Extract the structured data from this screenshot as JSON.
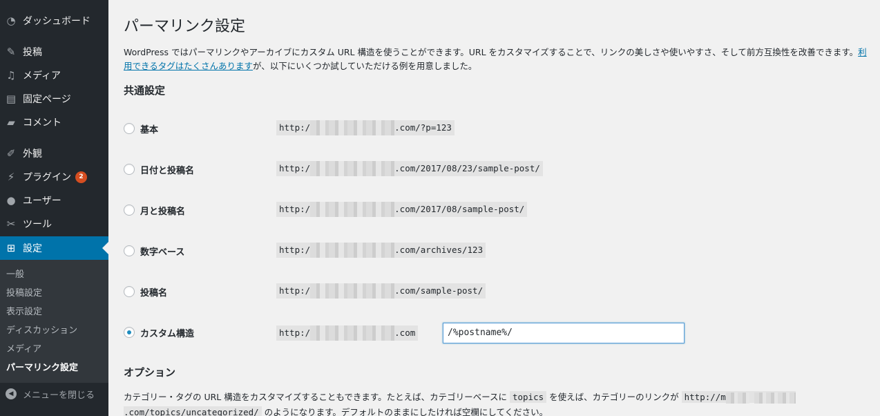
{
  "sidebar": {
    "items": [
      {
        "name": "dashboard",
        "label": "ダッシュボード",
        "icon": "dashboard-icon"
      },
      {
        "name": "posts",
        "label": "投稿",
        "icon": "pin-icon"
      },
      {
        "name": "media",
        "label": "メディア",
        "icon": "media-icon"
      },
      {
        "name": "pages",
        "label": "固定ページ",
        "icon": "page-icon"
      },
      {
        "name": "comments",
        "label": "コメント",
        "icon": "comment-icon"
      },
      {
        "name": "appearance",
        "label": "外観",
        "icon": "brush-icon"
      },
      {
        "name": "plugins",
        "label": "プラグイン",
        "icon": "plugin-icon",
        "badge": "2"
      },
      {
        "name": "users",
        "label": "ユーザー",
        "icon": "user-icon"
      },
      {
        "name": "tools",
        "label": "ツール",
        "icon": "wrench-icon"
      },
      {
        "name": "settings",
        "label": "設定",
        "icon": "settings-icon",
        "current": true
      }
    ],
    "submenu": [
      "一般",
      "投稿設定",
      "表示設定",
      "ディスカッション",
      "メディア",
      "パーマリンク設定"
    ],
    "collapse_label": "メニューを閉じる"
  },
  "main": {
    "title": "パーマリンク設定",
    "intro_before": "WordPress ではパーマリンクやアーカイブにカスタム URL 構造を使うことができます。URL をカスタマイズすることで、リンクの美しさや使いやすさ、そして前方互換性を改善できます。",
    "intro_link": "利用できるタグはたくさんあります",
    "intro_after": "が、以下にいくつか試していただける例を用意しました。",
    "common_heading": "共通設定",
    "options": [
      {
        "label": "基本",
        "prefix": "http:/",
        "suffix": ".com/?p=123",
        "checked": false
      },
      {
        "label": "日付と投稿名",
        "prefix": "http:/",
        "suffix": ".com/2017/08/23/sample-post/",
        "checked": false
      },
      {
        "label": "月と投稿名",
        "prefix": "http:/",
        "suffix": ".com/2017/08/sample-post/",
        "checked": false
      },
      {
        "label": "数字ベース",
        "prefix": "http:/",
        "suffix": ".com/archives/123",
        "checked": false
      },
      {
        "label": "投稿名",
        "prefix": "http:/",
        "suffix": ".com/sample-post/",
        "checked": false
      },
      {
        "label": "カスタム構造",
        "prefix": "http:/",
        "suffix": ".com",
        "checked": true,
        "input_value": "/%postname%/"
      }
    ],
    "options_heading": "オプション",
    "options_text_1": "カテゴリー・タグの URL 構造をカスタマイズすることもできます。たとえば、カテゴリーベースに",
    "options_code_1": "topics",
    "options_text_2": "を使えば、カテゴリーのリンクが",
    "options_code_2_prefix": "http://m",
    "options_code_2_suffix": ".com/topics/uncategorized/",
    "options_text_3": "のようになります。デフォルトのままにしたければ空欄にしてください。"
  },
  "colors": {
    "sidebar_bg": "#23282d",
    "accent": "#0073aa",
    "badge": "#d54e21",
    "page_bg": "#f1f1f1"
  }
}
